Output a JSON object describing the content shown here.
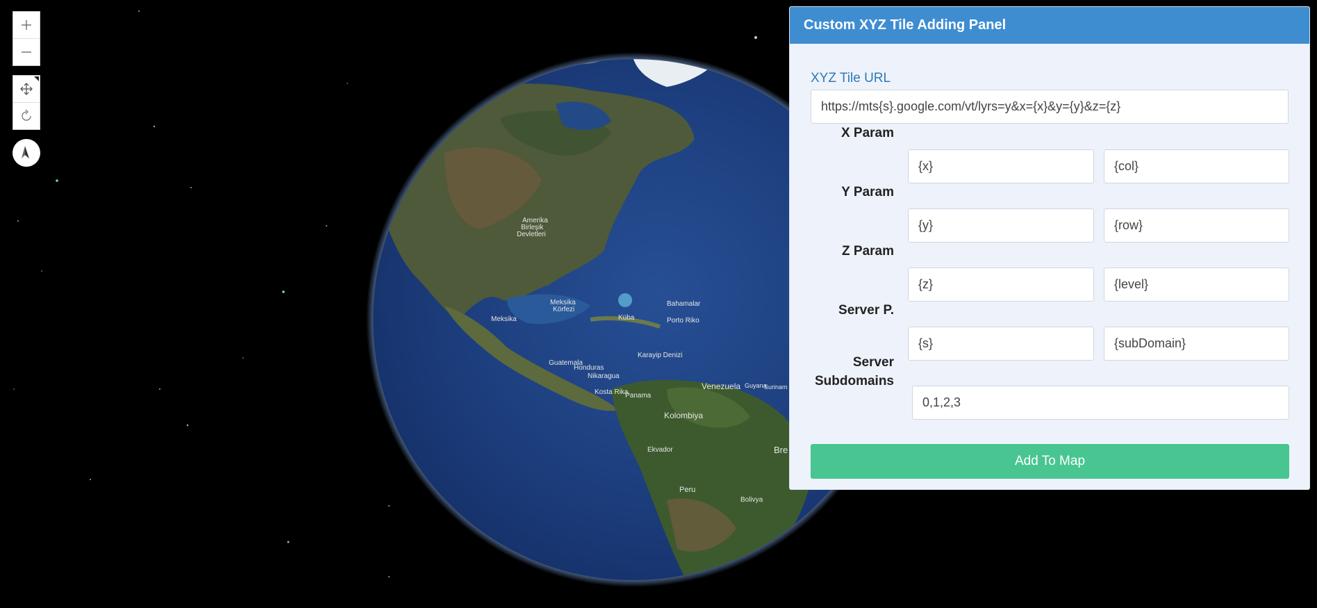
{
  "map": {
    "controls": {
      "zoom_in_icon": "plus-icon",
      "zoom_out_icon": "minus-icon",
      "pan_icon": "move-arrows-icon",
      "rotate_icon": "rotate-icon",
      "compass_icon": "compass-needle-icon"
    },
    "labels": {
      "amerika": "Amerika",
      "birlesik": "Birleşik",
      "devletleri": "Devletleri",
      "meksika": "Meksika",
      "meksika_korfezi_1": "Meksika",
      "meksika_korfezi_2": "Körfezi",
      "kuba": "Küba",
      "bahamalar": "Bahamalar",
      "porto_riko": "Porto Riko",
      "guatemala": "Guatemala",
      "honduras": "Honduras",
      "nikaragua": "Nikaragua",
      "kosta_rika": "Kosta Rika",
      "panama": "Panama",
      "karayip_denizi": "Karayip Denizi",
      "venezuela": "Venezuela",
      "guyana": "Guyana",
      "surinam": "Surinam",
      "kolombiya": "Kolombiya",
      "ekvador": "Ekvador",
      "peru": "Peru",
      "brezilya": "Bre",
      "bolivya": "Bolivya"
    }
  },
  "panel": {
    "title": "Custom XYZ Tile Adding Panel",
    "url_label": "XYZ Tile URL",
    "url_value": "https://mts{s}.google.com/vt/lyrs=y&x={x}&y={y}&z={z}",
    "rows": [
      {
        "label": "X Param",
        "a": "{x}",
        "b": "{col}"
      },
      {
        "label": "Y Param",
        "a": "{y}",
        "b": "{row}"
      },
      {
        "label": "Z Param",
        "a": "{z}",
        "b": "{level}"
      },
      {
        "label": "Server P.",
        "a": "{s}",
        "b": "{subDomain}"
      }
    ],
    "subdomains_label_1": "Server",
    "subdomains_label_2": "Subdomains",
    "subdomains_value": "0,1,2,3",
    "add_button": "Add To Map",
    "colors": {
      "header": "#3e8dd0",
      "button": "#48c590",
      "label_blue": "#2f78b5"
    }
  }
}
